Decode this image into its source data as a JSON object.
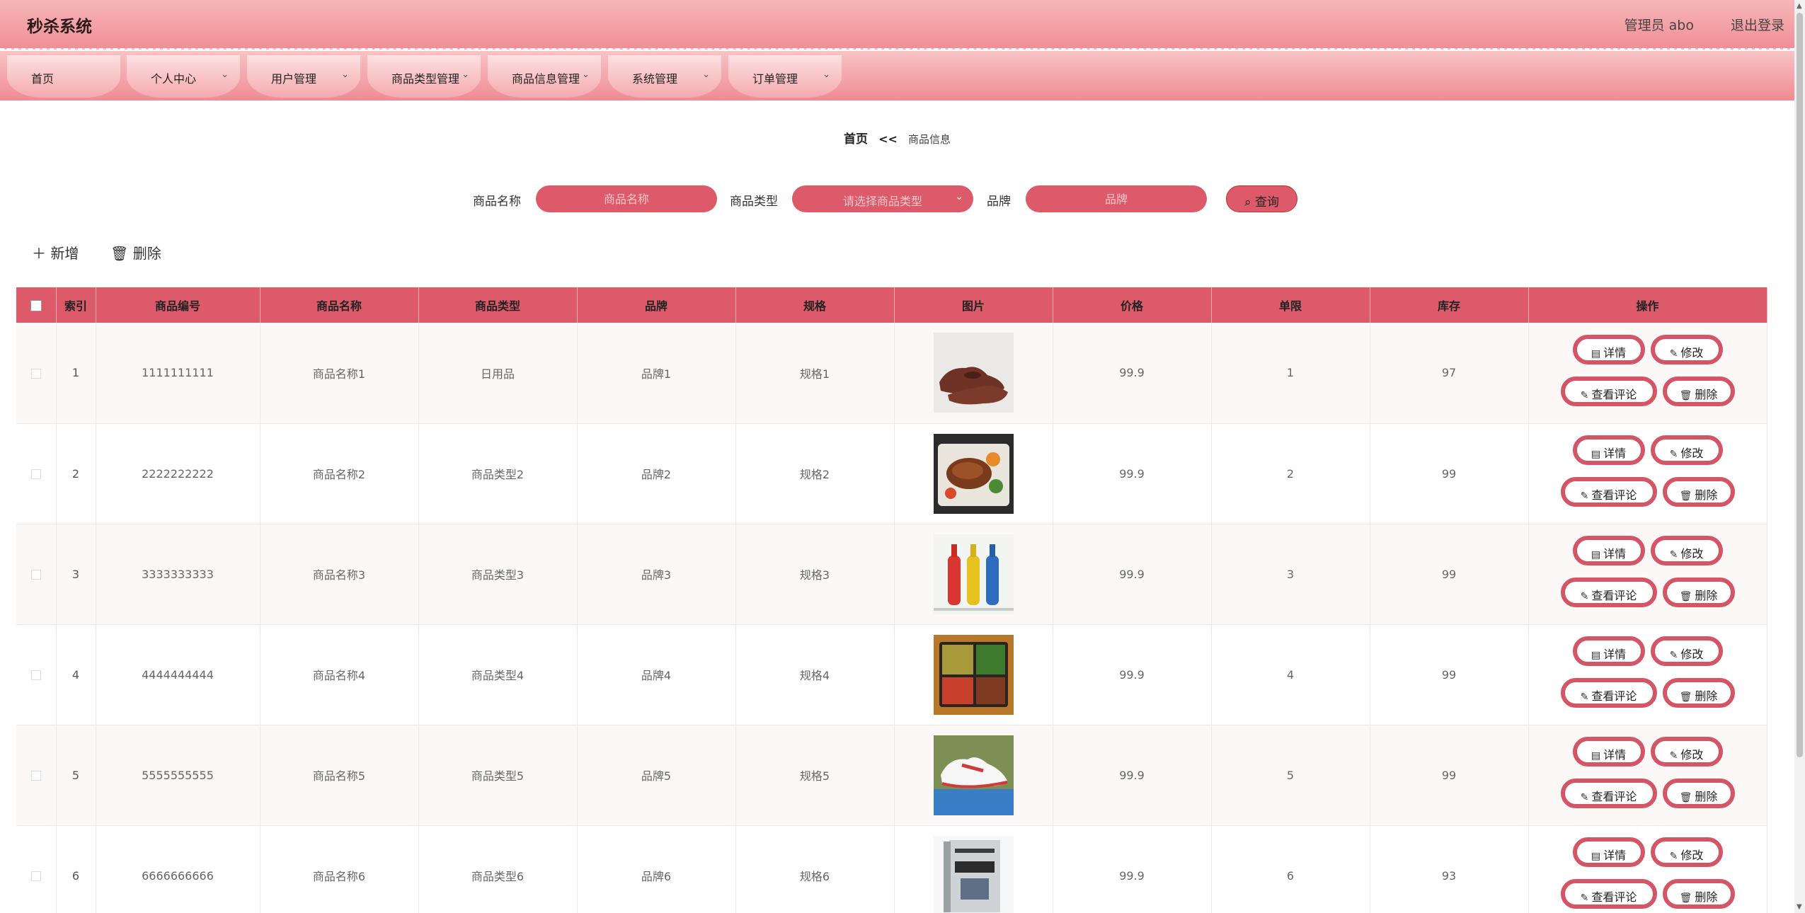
{
  "app": {
    "title": "秒杀系统",
    "user": "管理员 abo",
    "logout": "退出登录"
  },
  "nav": [
    {
      "label": "首页",
      "chevron": false
    },
    {
      "label": "个人中心",
      "chevron": true
    },
    {
      "label": "用户管理",
      "chevron": true
    },
    {
      "label": "商品类型管理",
      "chevron": true
    },
    {
      "label": "商品信息管理",
      "chevron": true
    },
    {
      "label": "系统管理",
      "chevron": true
    },
    {
      "label": "订单管理",
      "chevron": true
    }
  ],
  "breadcrumb": {
    "home": "首页",
    "sep": "<<",
    "current": "商品信息"
  },
  "search": {
    "name_label": "商品名称",
    "name_placeholder": "商品名称",
    "type_label": "商品类型",
    "type_placeholder": "请选择商品类型",
    "brand_label": "品牌",
    "brand_placeholder": "品牌",
    "query_label": "查询"
  },
  "toolbar": {
    "add_label": "新增",
    "delete_label": "删除"
  },
  "table": {
    "headers": [
      "索引",
      "商品编号",
      "商品名称",
      "商品类型",
      "品牌",
      "规格",
      "图片",
      "价格",
      "单限",
      "库存",
      "操作"
    ],
    "actions": {
      "detail": "详情",
      "edit": "修改",
      "comments": "查看评论",
      "delete": "删除"
    },
    "rows": [
      {
        "index": "1",
        "code": "1111111111",
        "name": "商品名称1",
        "type": "日用品",
        "brand": "品牌1",
        "spec": "规格1",
        "image": "brown-leather-shoe",
        "price": "99.9",
        "limit": "1",
        "stock": "97"
      },
      {
        "index": "2",
        "code": "2222222222",
        "name": "商品名称2",
        "type": "商品类型2",
        "brand": "品牌2",
        "spec": "规格2",
        "image": "grilled-meat-bento",
        "price": "99.9",
        "limit": "2",
        "stock": "99"
      },
      {
        "index": "3",
        "code": "3333333333",
        "name": "商品名称3",
        "type": "商品类型3",
        "brand": "品牌3",
        "spec": "规格3",
        "image": "three-bottles",
        "price": "99.9",
        "limit": "3",
        "stock": "99"
      },
      {
        "index": "4",
        "code": "4444444444",
        "name": "商品名称4",
        "type": "商品类型4",
        "brand": "品牌4",
        "spec": "规格4",
        "image": "lunch-box",
        "price": "99.9",
        "limit": "4",
        "stock": "99"
      },
      {
        "index": "5",
        "code": "5555555555",
        "name": "商品名称5",
        "type": "商品类型5",
        "brand": "品牌5",
        "spec": "规格5",
        "image": "white-sneaker",
        "price": "99.9",
        "limit": "5",
        "stock": "99"
      },
      {
        "index": "6",
        "code": "6666666666",
        "name": "商品名称6",
        "type": "商品类型6",
        "brand": "品牌6",
        "spec": "规格6",
        "image": "book",
        "price": "99.9",
        "limit": "6",
        "stock": "93"
      }
    ]
  },
  "colors": {
    "accent": "#dc5a6a",
    "header_from": "#f7b6b9",
    "header_to": "#f08f96",
    "button_border": "#d35566"
  }
}
